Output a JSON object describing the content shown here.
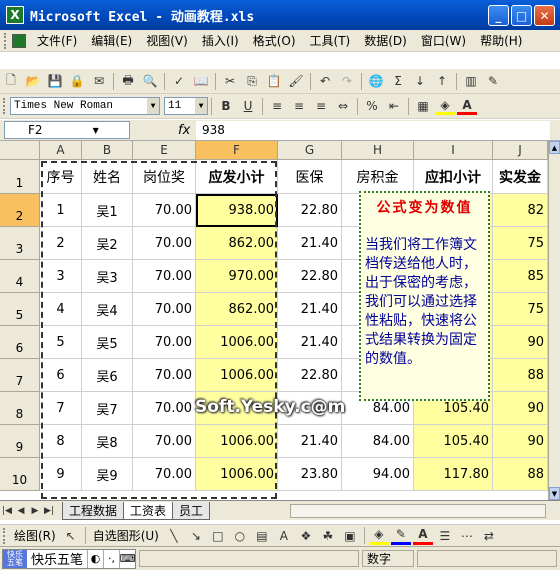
{
  "window": {
    "title": "Microsoft Excel - 动画教程.xls",
    "app_icon": "X"
  },
  "menu": [
    "文件(F)",
    "编辑(E)",
    "视图(V)",
    "插入(I)",
    "格式(O)",
    "工具(T)",
    "数据(D)",
    "窗口(W)",
    "帮助(H)"
  ],
  "format_toolbar": {
    "font": "Times New Roman",
    "size": "11"
  },
  "formula_bar": {
    "cell_ref": "F2",
    "fx": "fx",
    "value": "938"
  },
  "columns": [
    "A",
    "B",
    "E",
    "F",
    "G",
    "H",
    "I",
    "J"
  ],
  "header_row": [
    "序号",
    "姓名",
    "岗位奖",
    "应发小计",
    "医保",
    "房积金",
    "应扣小计",
    "实发金"
  ],
  "rows": [
    {
      "n": "2",
      "a": "1",
      "b": "吴1",
      "e": "70.00",
      "f": "938.00",
      "g": "22.80",
      "h": "",
      "i": "",
      "j": "82"
    },
    {
      "n": "3",
      "a": "2",
      "b": "吴2",
      "e": "70.00",
      "f": "862.00",
      "g": "21.40",
      "h": "",
      "i": "",
      "j": "75"
    },
    {
      "n": "4",
      "a": "3",
      "b": "吴3",
      "e": "70.00",
      "f": "970.00",
      "g": "22.80",
      "h": "",
      "i": "",
      "j": "85"
    },
    {
      "n": "5",
      "a": "4",
      "b": "吴4",
      "e": "70.00",
      "f": "862.00",
      "g": "21.40",
      "h": "",
      "i": "",
      "j": "75"
    },
    {
      "n": "6",
      "a": "5",
      "b": "吴5",
      "e": "70.00",
      "f": "1006.00",
      "g": "21.40",
      "h": "",
      "i": "",
      "j": "90"
    },
    {
      "n": "7",
      "a": "6",
      "b": "吴6",
      "e": "70.00",
      "f": "1006.00",
      "g": "22.80",
      "h": "",
      "i": "",
      "j": "88"
    },
    {
      "n": "8",
      "a": "7",
      "b": "吴7",
      "e": "70.00",
      "f": "",
      "g": "",
      "h": "84.00",
      "i": "105.40",
      "j": "90"
    },
    {
      "n": "9",
      "a": "8",
      "b": "吴8",
      "e": "70.00",
      "f": "1006.00",
      "g": "21.40",
      "h": "84.00",
      "i": "105.40",
      "j": "90"
    },
    {
      "n": "10",
      "a": "9",
      "b": "吴9",
      "e": "70.00",
      "f": "1006.00",
      "g": "23.80",
      "h": "94.00",
      "i": "117.80",
      "j": "88"
    }
  ],
  "row1_label": "1",
  "comment": {
    "title": "公式变为数值",
    "body": "当我们将工作簿文档传送给他人时，出于保密的考虑，我们可以通过选择性粘贴，快速将公式结果转换为固定的数值。"
  },
  "watermark": "Soft.Yesky.c@m",
  "sheet_tabs": [
    "工程数据",
    "工资表",
    "员工"
  ],
  "draw_toolbar": {
    "draw_label": "绘图(R)",
    "autoshape_label": "自选图形(U)"
  },
  "status": {
    "ime_name": "快乐五笔",
    "ime_logo": "快乐 五笔",
    "mode": "数字"
  }
}
